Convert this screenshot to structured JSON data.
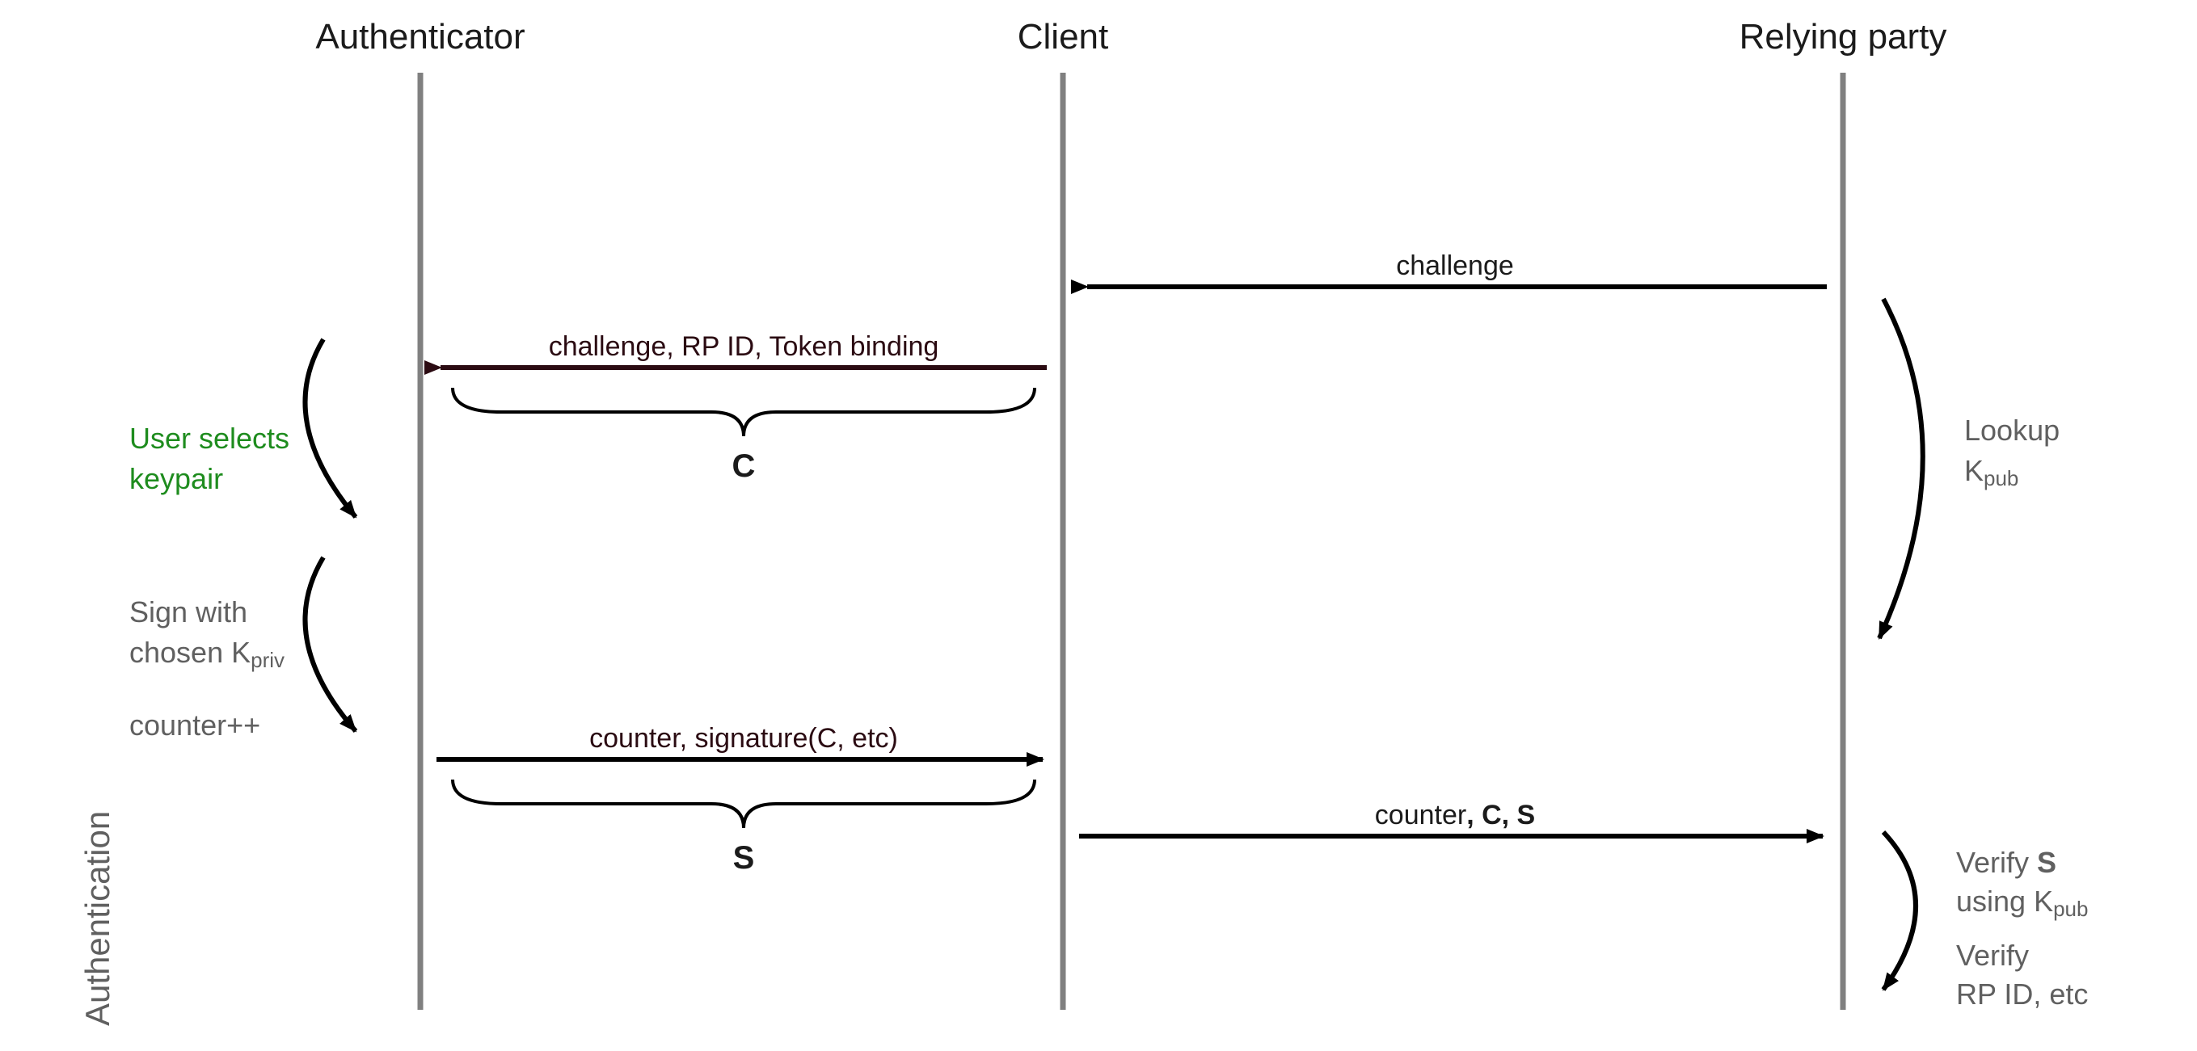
{
  "headers": {
    "authenticator": "Authenticator",
    "client": "Client",
    "relyingParty": "Relying party"
  },
  "sideLabel": "Authentication",
  "messages": {
    "rp_to_client": "challenge",
    "client_to_auth": "challenge, RP ID, Token binding",
    "client_to_auth_brace": "C",
    "auth_to_client": "counter, signature(C, etc)",
    "auth_to_client_brace": "S",
    "client_to_rp_pre": "counter",
    "client_to_rp_c": ", C",
    "client_to_rp_s": ", S"
  },
  "leftNotes": {
    "user1": "User selects",
    "user2": "keypair",
    "sign1": "Sign with",
    "sign2_pre": "chosen K",
    "sign2_sub": "priv",
    "counter": "counter++"
  },
  "rightNotes": {
    "lookup1": "Lookup",
    "lookup2_pre": "K",
    "lookup2_sub": "pub",
    "verify1_pre": "Verify ",
    "verify1_s": "S",
    "verify2_pre": "using K",
    "verify2_sub": "pub",
    "verify3": "Verify",
    "verify4": "RP ID, etc"
  }
}
